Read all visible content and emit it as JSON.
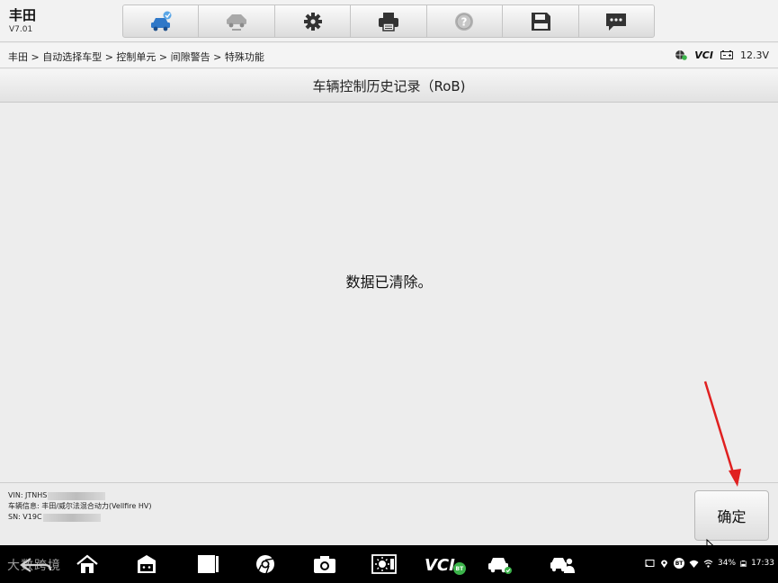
{
  "header": {
    "brand": "丰田",
    "version": "V7.01"
  },
  "toolbar": {
    "items": [
      {
        "name": "home-car-icon",
        "active": true
      },
      {
        "name": "vehicle-swap-icon",
        "active": false
      },
      {
        "name": "gear-icon",
        "active": true
      },
      {
        "name": "printer-icon",
        "active": true
      },
      {
        "name": "help-icon",
        "active": false
      },
      {
        "name": "save-icon",
        "active": true
      },
      {
        "name": "message-icon",
        "active": true
      }
    ]
  },
  "breadcrumb": {
    "path": "丰田 > 自动选择车型 > 控制单元 > 间隙警告 > 特殊功能"
  },
  "status": {
    "vci": "VCI",
    "voltage": "12.3V"
  },
  "page": {
    "title": "车辆控制历史记录（RoB)"
  },
  "main": {
    "message": "数据已清除。"
  },
  "footer": {
    "vin_label": "VIN: JTNHS",
    "vehicle_info": "车辆信息: 丰田/威尔法混合动力(Vellfire HV)",
    "sn_label": "SN: V19C",
    "ok_label": "确定"
  },
  "navbar": {
    "watermark": "大数跨境",
    "vci_label": "VCI",
    "vci_badge": "BT",
    "battery": "34%",
    "time": "17:33",
    "bt_label": "BT"
  },
  "colors": {
    "accent_blue": "#2f78c8",
    "arrow_red": "#e02020",
    "ok_green": "#3bb34a"
  }
}
